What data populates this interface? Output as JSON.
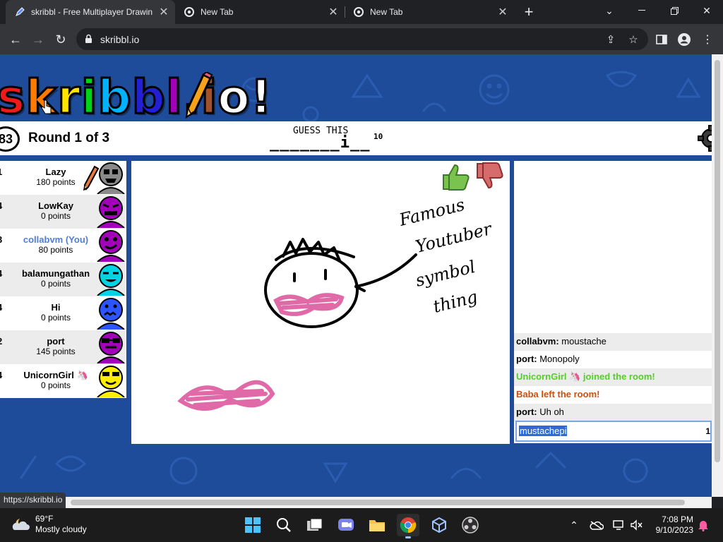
{
  "browser": {
    "tabs": [
      {
        "title": "skribbl - Free Multiplayer Drawin",
        "active": true
      },
      {
        "title": "New Tab",
        "active": false
      },
      {
        "title": "New Tab",
        "active": false
      }
    ],
    "new_tab_glyph": "+",
    "url": "skribbl.io",
    "status_link": "https://skribbl.io"
  },
  "game": {
    "logo": {
      "text": "skribbl.io",
      "letters": [
        "s",
        "k",
        "r",
        "i",
        "b",
        "b",
        "l",
        ".",
        "i",
        "o",
        "!"
      ],
      "colors": [
        "#ef1a1a",
        "#ff7a00",
        "#ffe400",
        "#00d419",
        "#00b2ff",
        "#231fd3",
        "#a300ba",
        "#d37caa",
        "#a0522d",
        "#ffffff",
        "#ffffff"
      ]
    },
    "timer": "83",
    "round_text": "Round 1 of 3",
    "hint_label": "GUESS THIS",
    "hint_word": "_______i__",
    "hint_length": "10"
  },
  "players": [
    {
      "rank": "1",
      "name": "Lazy",
      "points": "180 points",
      "drawing": true,
      "avatar_color": "#8a8a8a"
    },
    {
      "rank": "4",
      "name": "LowKay",
      "points": "0 points",
      "drawing": false,
      "avatar_color": "#a300ba"
    },
    {
      "rank": "3",
      "name": "collabvm (You)",
      "points": "80 points",
      "drawing": false,
      "avatar_color": "#a300ba"
    },
    {
      "rank": "4",
      "name": "balamungathan",
      "points": "0 points",
      "drawing": false,
      "avatar_color": "#00d3e4"
    },
    {
      "rank": "4",
      "name": "Hi",
      "points": "0 points",
      "drawing": false,
      "avatar_color": "#2c55ff"
    },
    {
      "rank": "2",
      "name": "port",
      "points": "145 points",
      "drawing": false,
      "avatar_color": "#a300ba"
    },
    {
      "rank": "4",
      "name": "UnicornGirl 🦄",
      "points": "0 points",
      "drawing": false,
      "avatar_color": "#ffee00"
    }
  ],
  "canvas": {
    "annotation_lines": [
      "Famous",
      "Youtuber",
      "symbol",
      "thing"
    ],
    "ink_color": "#000000",
    "mustache_color": "#e06aa8"
  },
  "chat": {
    "messages": [
      {
        "author": "collabvm:",
        "text": " moustache",
        "type": "normal"
      },
      {
        "author": "port:",
        "text": " Monopoly",
        "type": "normal"
      },
      {
        "author": "",
        "text": "UnicornGirl 🦄 joined the room!",
        "type": "join"
      },
      {
        "author": "",
        "text": "Baba left the room!",
        "type": "leave"
      },
      {
        "author": "port:",
        "text": " Uh oh",
        "type": "normal"
      }
    ],
    "input_value": "mustachepi",
    "input_counter": "1"
  },
  "taskbar": {
    "weather_temp": "69°F",
    "weather_desc": "Mostly cloudy",
    "time": "7:08 PM",
    "date": "9/10/2023"
  },
  "colors": {
    "page_bg": "#1f4c9a",
    "chrome_dark": "#202124",
    "chrome_toolbar": "#35363a",
    "you_name": "#4d7ed8",
    "join": "#56ce27",
    "leave": "#ce4f0a"
  }
}
